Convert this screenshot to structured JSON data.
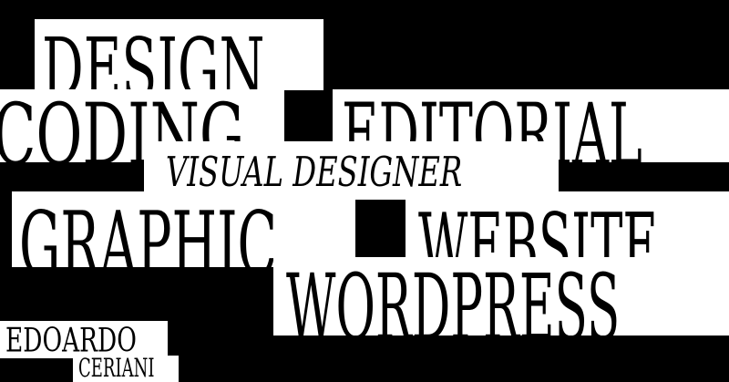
{
  "words": {
    "design": "DESIGN",
    "coding": "CODING",
    "editorial": "EDITORIAL",
    "visual_designer": "VISUAL DESIGNER",
    "graphic": "GRAPHIC",
    "website": "WEBSITE",
    "wordpress": "WORDPRESS"
  },
  "name": {
    "first": "EDOARDO",
    "last": "CERIANI"
  },
  "colors": {
    "background": "#000000",
    "box": "#ffffff",
    "text": "#000000"
  }
}
